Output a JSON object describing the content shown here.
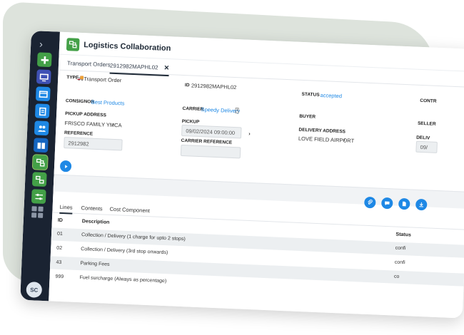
{
  "app": {
    "title": "Logistics Collaboration"
  },
  "sidebar": {
    "avatar_initials": "SC"
  },
  "tabs": [
    {
      "label": "Transport Orders"
    },
    {
      "label": "2912982MAPHL02"
    }
  ],
  "order": {
    "type_label": "TYPE",
    "type_value": "Transport Order",
    "id_label": "ID",
    "id_value": "2912982MAPHL02",
    "status_label": "STATUS",
    "status_value": "accepted",
    "contr_label": "CONTR",
    "consignor_label": "CONSIGNOR",
    "consignor_value": "Best Products",
    "carrier_label": "CARRIER",
    "carrier_value": "Speedy Delivery",
    "buyer_label": "BUYER",
    "seller_label": "SELLER",
    "pickup_address_label": "PICKUP ADDRESS",
    "pickup_address_value": "FRISCO FAMILY YMCA",
    "pickup_label": "PICKUP",
    "pickup_value": "09/02/2024 09:00:00",
    "delivery_address_label": "DELIVERY ADDRESS",
    "delivery_address_value": "LOVE FIELD AIRPORT",
    "delivery_label": "DELIV",
    "delivery_value": "09/",
    "reference_label": "REFERENCE",
    "reference_value": "2912982",
    "carrier_reference_label": "CARRIER REFERENCE",
    "carrier_reference_value": ""
  },
  "subtabs": [
    {
      "label": "Lines"
    },
    {
      "label": "Contents"
    },
    {
      "label": "Cost Component"
    }
  ],
  "table": {
    "headers": {
      "id": "ID",
      "description": "Description",
      "status": "Status"
    },
    "rows": [
      {
        "id": "01",
        "description": "Collection / Delivery (1 charge for upto 2 stops)",
        "status": "confi"
      },
      {
        "id": "02",
        "description": "Collection / Delivery (3rd stop onwards)",
        "status": "confi"
      },
      {
        "id": "43",
        "description": "Parking Fees",
        "status": "co"
      },
      {
        "id": "999",
        "description": "Fuel surcharge (Always as percentage)",
        "status": ""
      }
    ]
  },
  "colors": {
    "sidebar": "#1a2332",
    "accent": "#1e88e5",
    "brand_green": "#43a047"
  }
}
